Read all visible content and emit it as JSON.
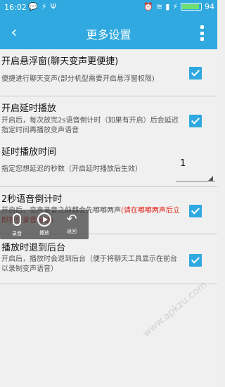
{
  "status_bar": {
    "time": "16:02",
    "battery": "94",
    "left_icons": [
      "message-icon",
      "usb-icon",
      "usb-debug-icon"
    ],
    "right_icons": [
      "alarm-icon",
      "wifi-icon",
      "signal-icon",
      "charging-icon"
    ]
  },
  "header": {
    "title": "更多设置",
    "back_icon": "back-arrow-icon",
    "menu_icon": "more-vert-icon",
    "color": "#2fa9df"
  },
  "settings": [
    {
      "title": "开启悬浮窗(聊天变声更便捷)",
      "desc": "便捷进行聊天变声(部分机型需要开启悬浮窗权限)",
      "checked": true
    },
    {
      "title": "开启延时播放",
      "desc": "开启后，每次放完2s语音倒计时（如果有开启）后会延迟指定时间再播放变声语音",
      "checked": true
    },
    {
      "title": "延时播放时间",
      "desc": "指定您想延迟的秒数（开启延时播放后生效）",
      "value": "1"
    },
    {
      "title": "2秒语音倒计时",
      "desc_prefix": "开启后，变声录音之前都会先嘟嘟两声",
      "desc_red": "(请在嘟嘟两声后立即按住录音按钮)",
      "checked": true
    },
    {
      "title": "播放时退到后台",
      "desc": "开启后，播放时会退到后台（便于将聊天工具显示在前台以录制变声语音）",
      "checked": true
    }
  ],
  "float_bar": {
    "record": "录音",
    "play": "播放",
    "back": "返回"
  },
  "watermark": "www.apkzu.com"
}
